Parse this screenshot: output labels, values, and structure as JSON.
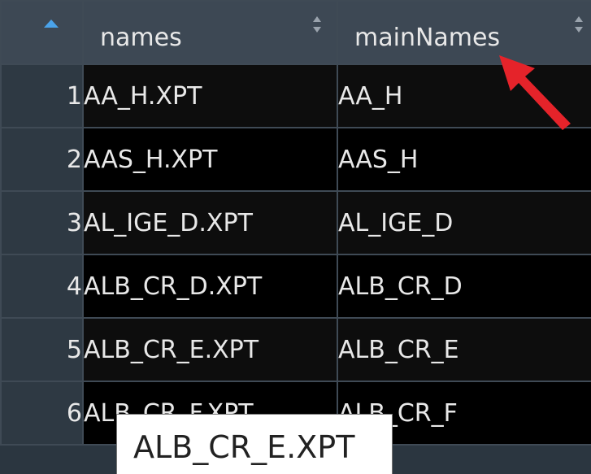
{
  "table": {
    "columns": [
      {
        "label": "",
        "sort": "asc"
      },
      {
        "label": "names",
        "sort": "both"
      },
      {
        "label": "mainNames",
        "sort": "both"
      }
    ],
    "rows": [
      {
        "index": "1",
        "names": "AA_H.XPT",
        "mainNames": "AA_H"
      },
      {
        "index": "2",
        "names": "AAS_H.XPT",
        "mainNames": "AAS_H"
      },
      {
        "index": "3",
        "names": "AL_IGE_D.XPT",
        "mainNames": "AL_IGE_D"
      },
      {
        "index": "4",
        "names": "ALB_CR_D.XPT",
        "mainNames": "ALB_CR_D"
      },
      {
        "index": "5",
        "names": "ALB_CR_E.XPT",
        "mainNames": "ALB_CR_E"
      },
      {
        "index": "6",
        "names": "ALB_CR_F.XPT",
        "mainNames": "ALB_CR_F"
      }
    ]
  },
  "tooltip": {
    "text": "ALB_CR_E.XPT"
  },
  "colors": {
    "header_bg": "#3d4854",
    "cell_bg": "#000000",
    "sort_active": "#4aa3ea",
    "annotation_arrow": "#e5232a"
  },
  "icons": [
    "sort-ascending-icon",
    "sort-both-icon",
    "annotation-arrow-icon"
  ]
}
